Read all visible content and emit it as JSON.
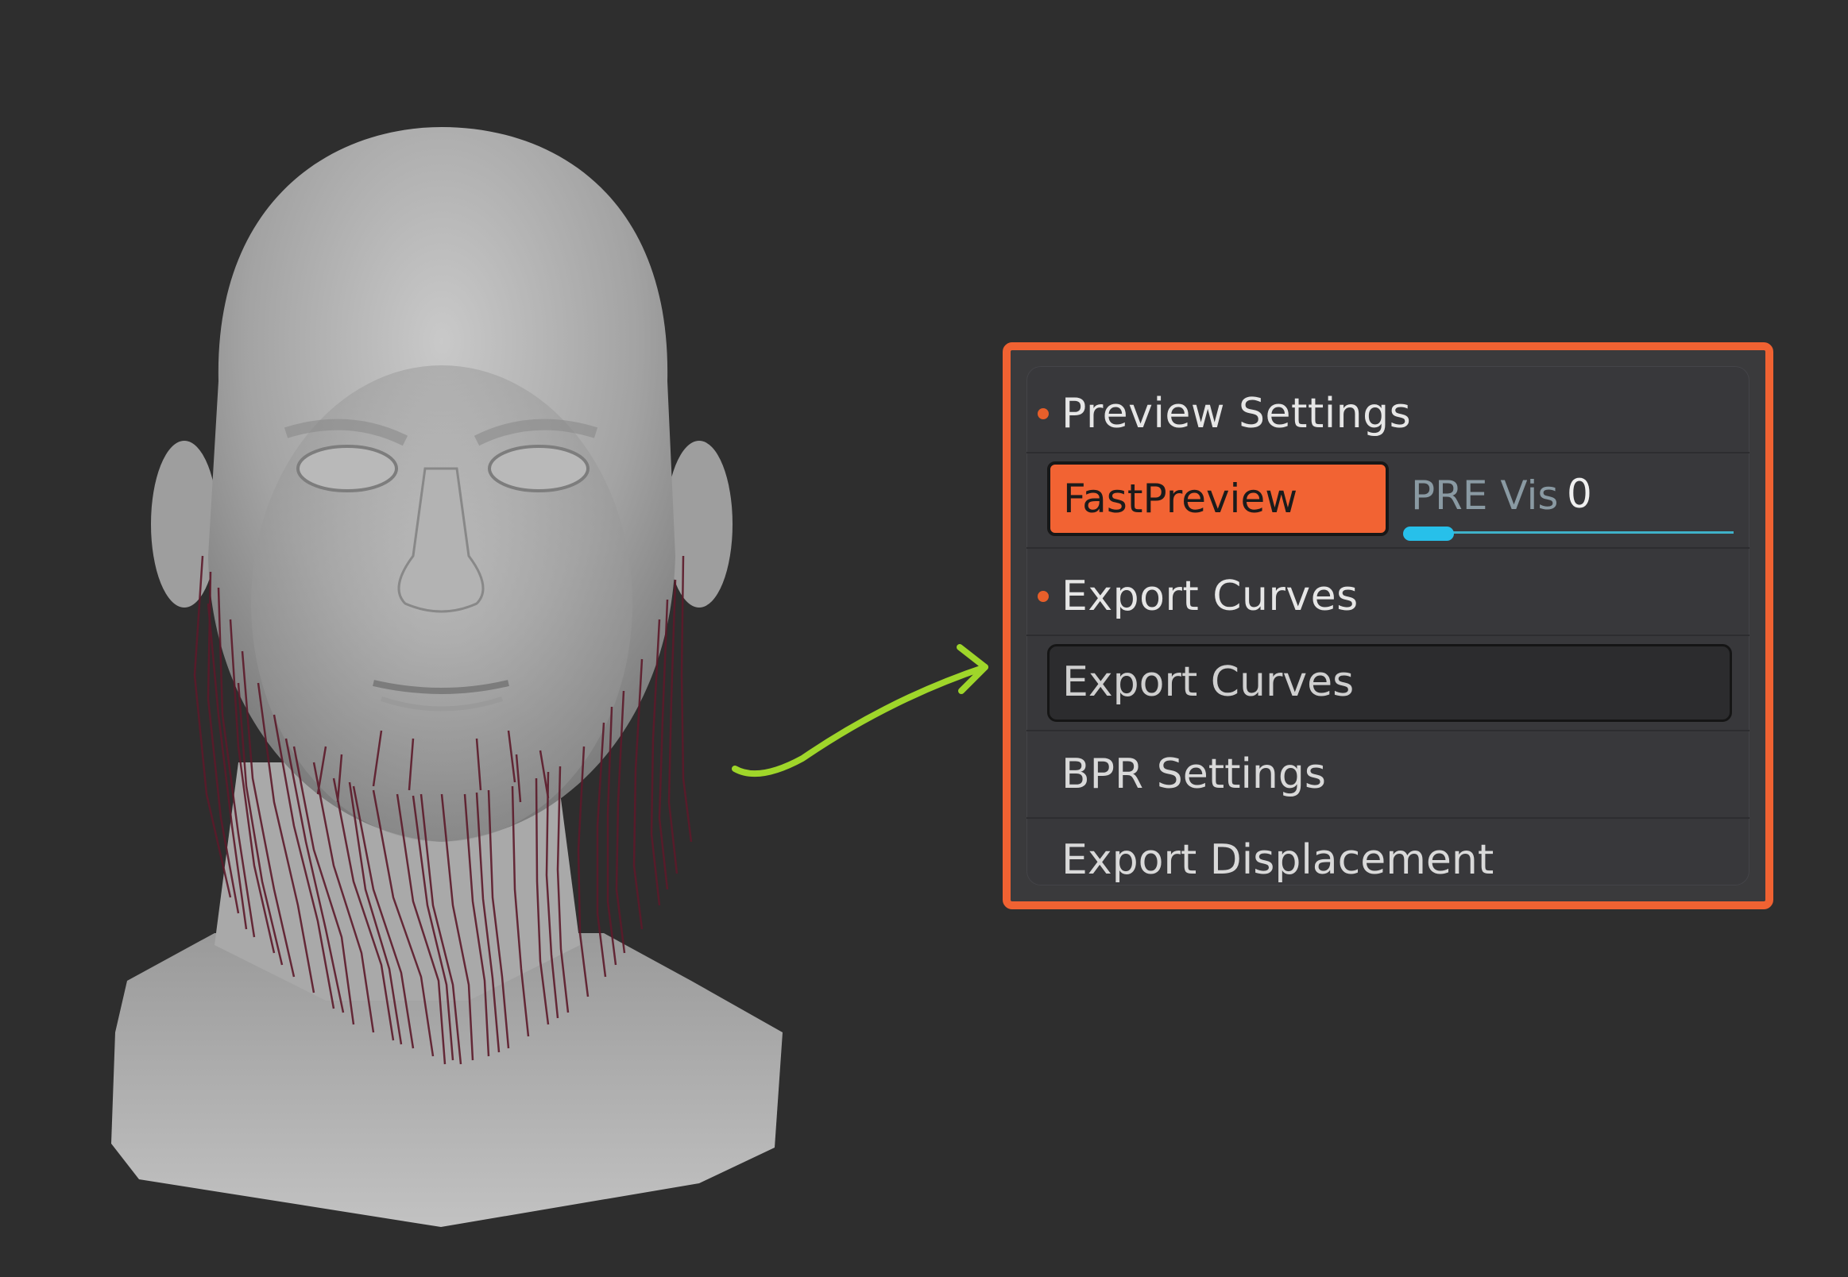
{
  "colors": {
    "background": "#2e2e2e",
    "highlight_border": "#f06232",
    "fast_preview_fill": "#f26333",
    "slider_handle": "#27c0ea",
    "arrow": "#9fd62a",
    "hair": "#5c1a2a"
  },
  "panel": {
    "preview_section_title": "Preview Settings",
    "fast_preview_label": "FastPreview",
    "pre_vis_label": "PRE Vis",
    "pre_vis_value": "0",
    "export_section_title": "Export Curves",
    "export_curves_button": "Export Curves",
    "bpr_settings_label": "BPR Settings",
    "export_displacement_label": "Export Displacement"
  },
  "icons": {
    "arrow": "curved-arrow-icon",
    "section_marker": "orange-dot-icon"
  }
}
